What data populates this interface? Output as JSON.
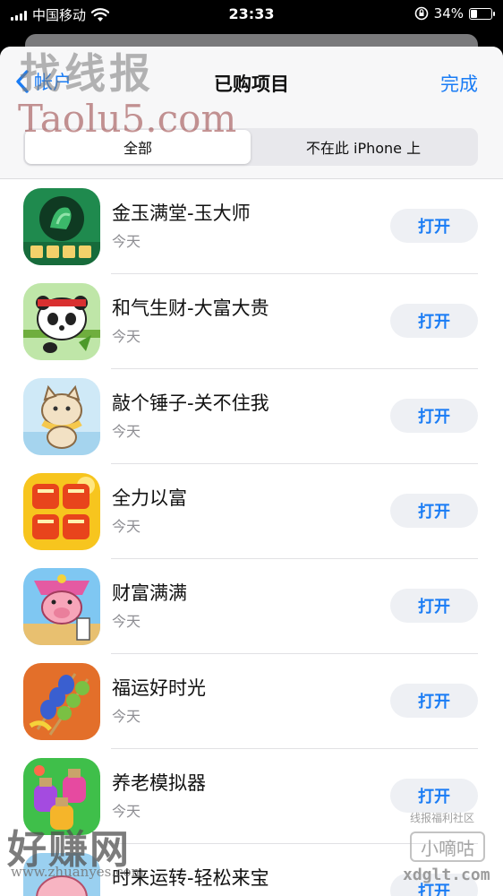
{
  "status_bar": {
    "carrier": "中国移动",
    "time": "23:33",
    "battery_pct": "34%",
    "battery_level": 0.34,
    "icons": [
      "signal-icon",
      "wifi-icon",
      "orientation-lock-icon",
      "battery-icon"
    ]
  },
  "nav": {
    "back_label": "帐户",
    "title": "已购项目",
    "done_label": "完成"
  },
  "segments": {
    "all": "全部",
    "not_on_device": "不在此 iPhone 上",
    "selected": "all"
  },
  "apps": [
    {
      "name": "金玉满堂-玉大师",
      "subtitle": "今天",
      "button": "打开",
      "icon": "jinyu-mantang-app-icon"
    },
    {
      "name": "和气生财-大富大贵",
      "subtitle": "今天",
      "button": "打开",
      "icon": "panda-app-icon"
    },
    {
      "name": "敲个锤子-关不住我",
      "subtitle": "今天",
      "button": "打开",
      "icon": "cat-app-icon"
    },
    {
      "name": "全力以富",
      "subtitle": "今天",
      "button": "打开",
      "icon": "quanli-yifu-app-icon"
    },
    {
      "name": "财富满满",
      "subtitle": "今天",
      "button": "打开",
      "icon": "pig-clown-app-icon"
    },
    {
      "name": "福运好时光",
      "subtitle": "今天",
      "button": "打开",
      "icon": "skewer-app-icon"
    },
    {
      "name": "养老模拟器",
      "subtitle": "今天",
      "button": "打开",
      "icon": "potion-app-icon"
    },
    {
      "name": "时来运转-轻松来宝",
      "subtitle": "",
      "button": "打开",
      "icon": "pig-app-icon"
    }
  ],
  "watermarks": {
    "top_logo": "找线报",
    "top_url": "Taolu5.com",
    "bottom_logo": "好赚网",
    "bottom_url": "www.zhuanyes.com",
    "forum_label": "线报福利社区",
    "badge": "小嘀咕",
    "badge_url": "xdglt.com"
  },
  "colors": {
    "accent": "#1a7cf5",
    "button_bg": "#eef0f4",
    "separator": "#e1e1e4"
  }
}
